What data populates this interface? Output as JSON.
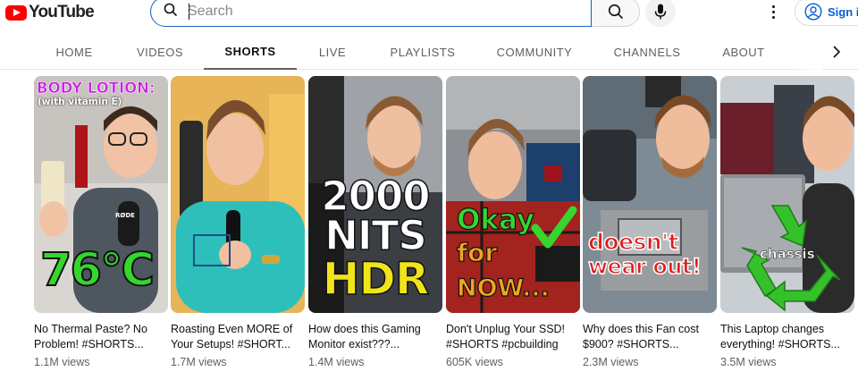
{
  "header": {
    "logo_text": "YouTube",
    "search_placeholder": "Search",
    "signin_label": "Sign in",
    "icons": [
      "youtube-logo-icon",
      "search-icon",
      "mic-icon",
      "more-vert-icon",
      "account-icon"
    ]
  },
  "tabs": [
    {
      "label": "HOME"
    },
    {
      "label": "VIDEOS"
    },
    {
      "label": "SHORTS",
      "active": true
    },
    {
      "label": "LIVE"
    },
    {
      "label": "PLAYLISTS"
    },
    {
      "label": "COMMUNITY"
    },
    {
      "label": "CHANNELS"
    },
    {
      "label": "ABOUT"
    }
  ],
  "shorts": [
    {
      "title": "No Thermal Paste? No Problem! #SHORTS...",
      "views": "1.1M views",
      "overlay_top": "BODY LOTION:",
      "overlay_sub": "(with vitamin E)",
      "overlay_big": "76°C",
      "mic_text": "RØDE"
    },
    {
      "title": "Roasting Even MORE of Your Setups! #SHORT...",
      "views": "1.7M views"
    },
    {
      "title": "How does this Gaming Monitor exist???...",
      "views": "1.4M views",
      "overlay_line1": "2000",
      "overlay_line2": "NITS",
      "overlay_line3": "HDR"
    },
    {
      "title": "Don't Unplug Your SSD! #SHORTS #pcbuilding",
      "views": "605K views",
      "overlay_line1": "Okay",
      "overlay_line2": "for",
      "overlay_line3": "NOW..."
    },
    {
      "title": "Why does this Fan cost $900? #SHORTS...",
      "views": "2.3M views",
      "overlay_line1": "doesn't",
      "overlay_line2": "wear out!"
    },
    {
      "title": "This Laptop changes everything! #SHORTS...",
      "views": "3.5M views",
      "overlay_word": "chassis"
    }
  ],
  "colors": {
    "brand_red": "#ff0000",
    "link_blue": "#065fd4",
    "overlay_green": "#35d62e",
    "overlay_magenta": "#c81ee0",
    "overlay_yellow": "#f0e41a",
    "overlay_red": "#e11d1d",
    "overlay_orange": "#f2a51e"
  }
}
